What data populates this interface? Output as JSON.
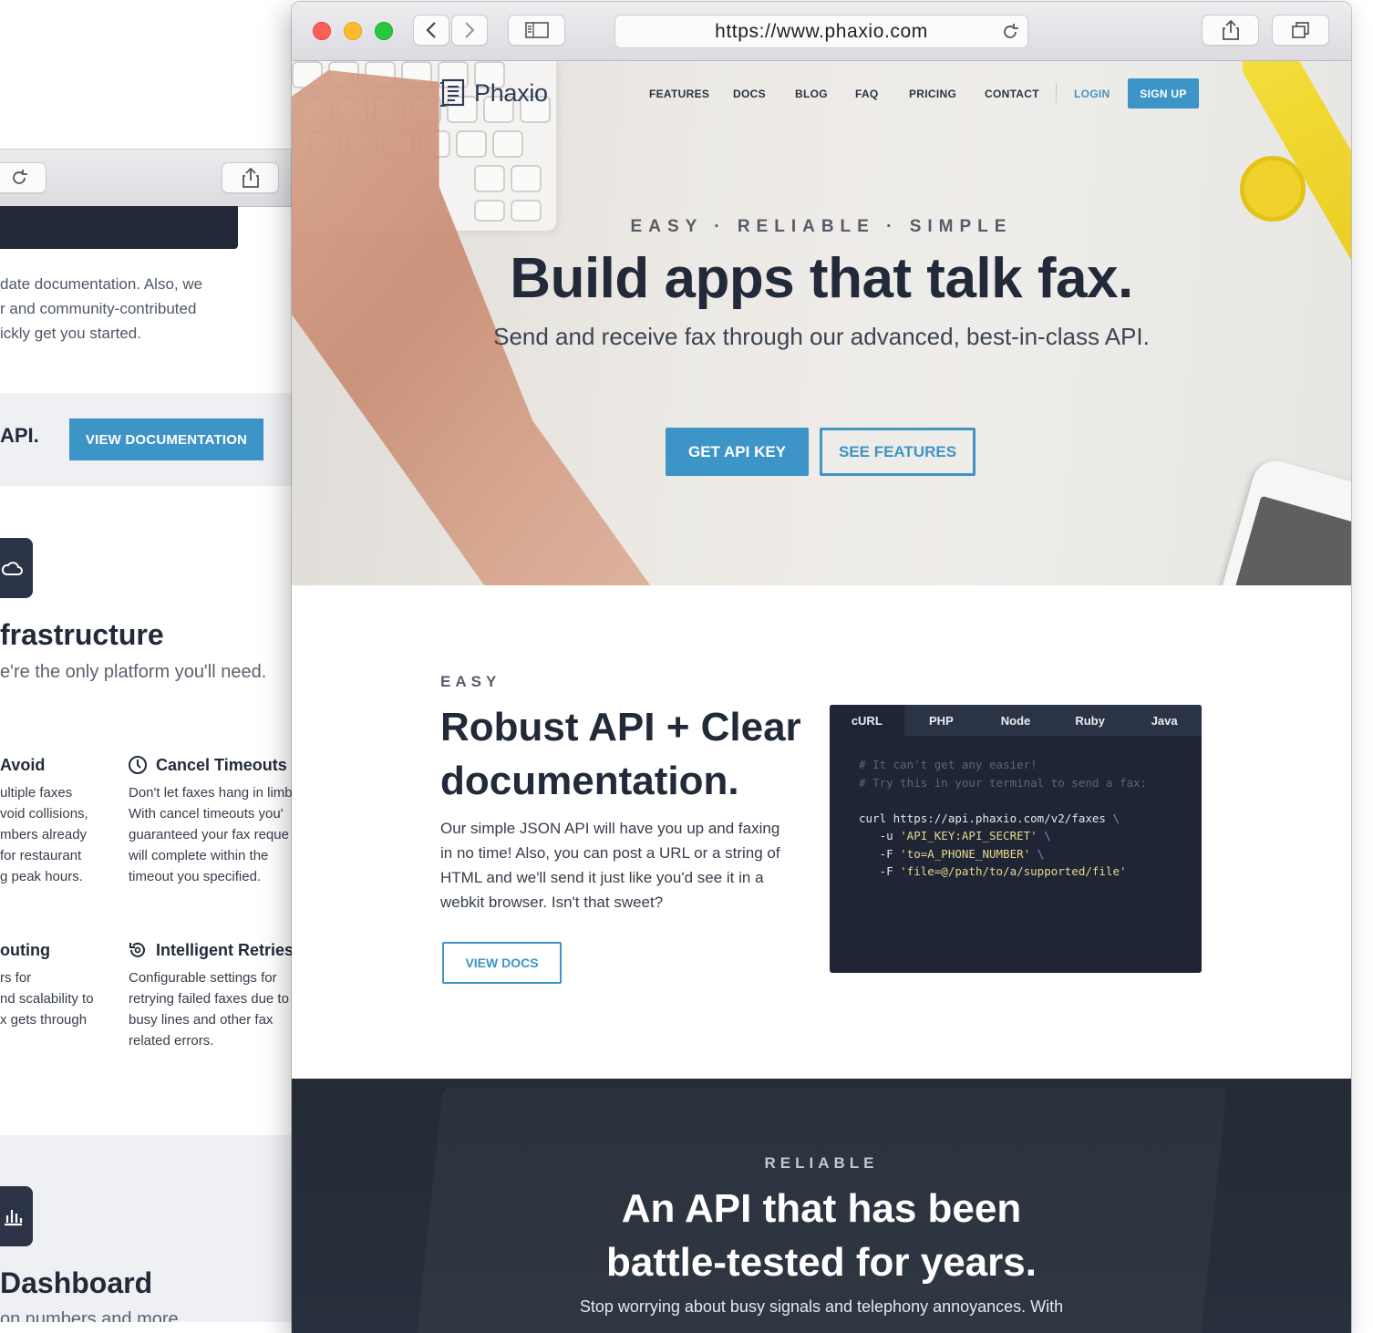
{
  "back_window": {
    "body_lines": [
      "date documentation. Also, we",
      "r and community-contributed",
      "ickly get you started."
    ],
    "cta_fragment": "API.",
    "view_documentation": "VIEW DOCUMENTATION",
    "infrastructure_heading": "frastructure",
    "infrastructure_sub": "e're the only platform you'll need.",
    "features": [
      {
        "title": "Avoid",
        "lines": [
          "ultiple faxes",
          "void collisions,",
          "mbers already",
          "for restaurant",
          "g peak hours."
        ]
      },
      {
        "title": "Cancel Timeouts",
        "lines": [
          "Don't let faxes hang in limb",
          "With cancel timeouts you'",
          "guaranteed your fax reque",
          "will complete within the",
          "timeout you specified."
        ]
      },
      {
        "title": "outing",
        "lines": [
          "rs for",
          "nd scalability to",
          "x gets through"
        ]
      },
      {
        "title": "Intelligent Retries",
        "lines": [
          "Configurable settings for",
          "retrying failed faxes due to",
          "busy lines and other fax",
          "related errors."
        ]
      }
    ],
    "dashboard_heading": "Dashboard",
    "dashboard_sub": "on numbers and more"
  },
  "browser": {
    "url": "https://www.phaxio.com"
  },
  "nav": {
    "logo": "Phaxio",
    "features": "FEATURES",
    "docs": "DOCS",
    "blog": "BLOG",
    "faq": "FAQ",
    "pricing": "PRICING",
    "contact": "CONTACT",
    "login": "LOGIN",
    "signup": "SIGN UP"
  },
  "hero": {
    "eyebrow": "EASY · RELIABLE · SIMPLE",
    "title": "Build apps that talk fax.",
    "subtitle": "Send and receive fax through our advanced, best-in-class API.",
    "primary_button": "GET API KEY",
    "secondary_button": "SEE FEATURES"
  },
  "easy": {
    "eyebrow": "EASY",
    "title": "Robust API + Clear documentation.",
    "body": "Our simple JSON API will have you up and faxing in no time! Also, you can post a URL or a string of HTML and we'll send it just like you'd see it in a webkit browser. Isn't that sweet?",
    "button": "VIEW DOCS",
    "code_tabs": [
      "cURL",
      "PHP",
      "Node",
      "Ruby",
      "Java"
    ],
    "active_tab": "cURL",
    "code": {
      "comment1": "# It can't get any easier!",
      "comment2": "# Try this in your terminal to send a fax:",
      "cmd": "curl https://api.phaxio.com/v2/faxes",
      "arg1_flag": "   -u ",
      "arg1_val": "'API_KEY:API_SECRET'",
      "arg2_flag": "   -F ",
      "arg2_val": "'to=A_PHONE_NUMBER'",
      "arg3_flag": "   -F ",
      "arg3_val": "'file=@/path/to/a/supported/file'",
      "continuation": "\\"
    }
  },
  "reliable": {
    "eyebrow": "RELIABLE",
    "title_line1": "An API that has been",
    "title_line2": "battle-tested for years.",
    "body": "Stop worrying about busy signals and telephony annoyances. With"
  },
  "colors": {
    "accent": "#3d94c6",
    "dark": "#222a3a",
    "code_bg": "#1f2535"
  }
}
